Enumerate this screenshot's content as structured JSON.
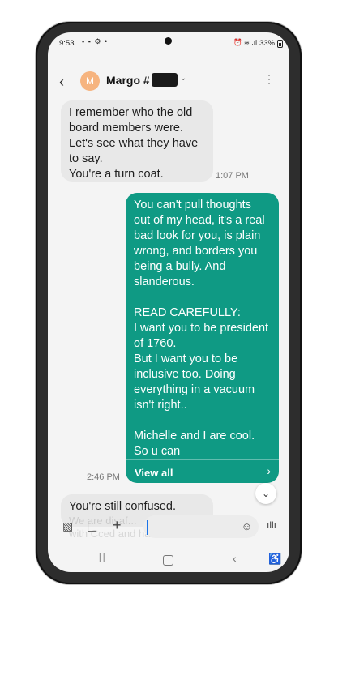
{
  "status_bar": {
    "time": "9:53",
    "left_icons": "▪ ▪ ⚙ •",
    "right_icons": "⏰ ≋ .ıl",
    "battery": "33%"
  },
  "header": {
    "back_icon": "back-arrow-icon",
    "avatar_letter": "M",
    "contact_name": "Margo #",
    "more_icon": "more-vertical-icon"
  },
  "messages": [
    {
      "direction": "incoming",
      "text": "I remember who the old board members were. Let's see what they have to say.\nYou're a turn coat.",
      "time": "1:07 PM"
    },
    {
      "direction": "outgoing",
      "text": "You can't pull thoughts out of my head, it's a real bad look for you, is plain wrong, and borders you being a bully. And slanderous.\n\nREAD CAREFULLY:\nI want you to be president of 1760.\nBut I want you to be inclusive too. Doing everything in a vacuum isn't right..\n\nMichelle and I are cool. So u can",
      "time": "2:46 PM",
      "view_all": "View all"
    },
    {
      "direction": "incoming",
      "text": "You're still confused."
    }
  ],
  "ghost_text": "We are disaf...\nwith Cced and have",
  "composer": {
    "placeholder": ""
  },
  "colors": {
    "outgoing_bubble": "#0f9a84",
    "incoming_bubble": "#e8e8e8",
    "avatar": "#f6b47f"
  }
}
